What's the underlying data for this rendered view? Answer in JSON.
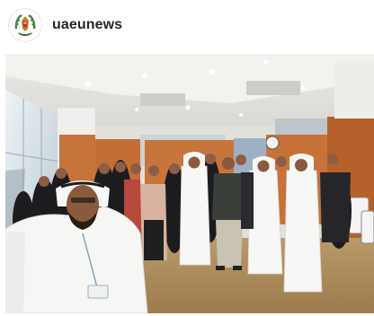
{
  "post": {
    "username": "uaeunews",
    "avatar_icon": "uae-university-emblem-icon",
    "image_alt": "group-photo-selfie"
  },
  "colors": {
    "username_text": "#262626",
    "background": "#ffffff"
  }
}
